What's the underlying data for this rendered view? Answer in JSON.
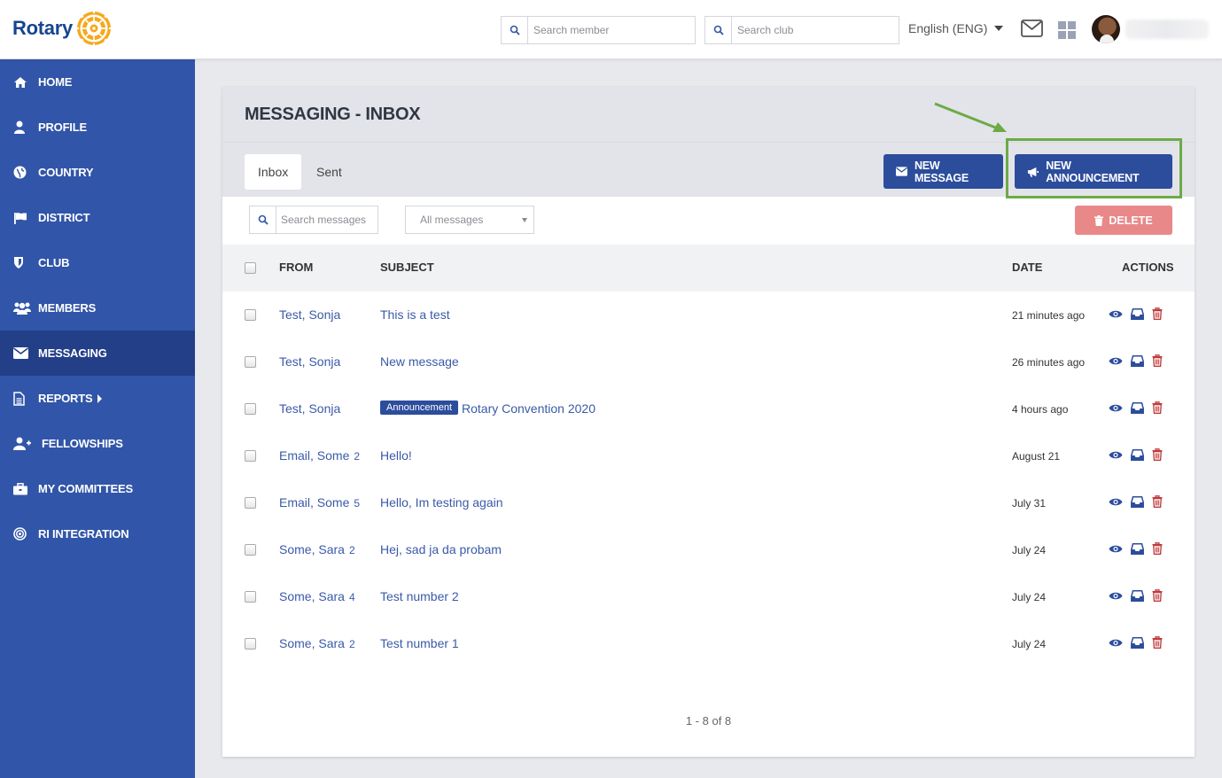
{
  "brand": {
    "name": "Rotary"
  },
  "header": {
    "search_member_placeholder": "Search member",
    "search_club_placeholder": "Search club",
    "language": "English (ENG)"
  },
  "sidebar": {
    "items": [
      {
        "label": "HOME",
        "icon": "home-icon"
      },
      {
        "label": "PROFILE",
        "icon": "user-icon"
      },
      {
        "label": "COUNTRY",
        "icon": "globe-icon"
      },
      {
        "label": "DISTRICT",
        "icon": "flag-icon"
      },
      {
        "label": "CLUB",
        "icon": "shield-icon"
      },
      {
        "label": "MEMBERS",
        "icon": "users-icon"
      },
      {
        "label": "MESSAGING",
        "icon": "envelope-icon",
        "active": true
      },
      {
        "label": "REPORTS",
        "icon": "file-icon",
        "has_submenu": true
      },
      {
        "label": "FELLOWSHIPS",
        "icon": "user-plus-icon"
      },
      {
        "label": "MY COMMITTEES",
        "icon": "briefcase-icon"
      },
      {
        "label": "RI INTEGRATION",
        "icon": "target-icon"
      }
    ]
  },
  "main": {
    "title": "MESSAGING - INBOX",
    "tabs": [
      {
        "label": "Inbox",
        "active": true
      },
      {
        "label": "Sent",
        "active": false
      }
    ],
    "new_message_label": "NEW MESSAGE",
    "new_announcement_label": "NEW ANNOUNCEMENT",
    "search_messages_placeholder": "Search messages",
    "filter_selected": "All messages",
    "delete_label": "DELETE",
    "columns": {
      "from": "FROM",
      "subject": "SUBJECT",
      "date": "DATE",
      "actions": "ACTIONS"
    },
    "rows": [
      {
        "from": "Test, Sonja",
        "count": "",
        "badge": "",
        "subject": "This is a test",
        "date": "21 minutes ago"
      },
      {
        "from": "Test, Sonja",
        "count": "",
        "badge": "",
        "subject": "New message",
        "date": "26 minutes ago"
      },
      {
        "from": "Test, Sonja",
        "count": "",
        "badge": "Announcement",
        "subject": "Rotary Convention 2020",
        "date": "4 hours ago"
      },
      {
        "from": "Email, Some",
        "count": "2",
        "badge": "",
        "subject": "Hello!",
        "date": "August 21"
      },
      {
        "from": "Email, Some",
        "count": "5",
        "badge": "",
        "subject": "Hello, Im testing again",
        "date": "July 31"
      },
      {
        "from": "Some, Sara",
        "count": "2",
        "badge": "",
        "subject": "Hej, sad ja da probam",
        "date": "July 24"
      },
      {
        "from": "Some, Sara",
        "count": "4",
        "badge": "",
        "subject": "Test number 2",
        "date": "July 24"
      },
      {
        "from": "Some, Sara",
        "count": "2",
        "badge": "",
        "subject": "Test number 1",
        "date": "July 24"
      }
    ],
    "pagination": "1 - 8 of 8"
  },
  "colors": {
    "sidebar": "#3155a8",
    "sidebar_active": "#233f88",
    "primary_button": "#2c4d9c",
    "delete_button": "#e98889",
    "link": "#3a5aa8",
    "highlight": "#6daa47",
    "rotary_gold": "#f7a81b"
  }
}
